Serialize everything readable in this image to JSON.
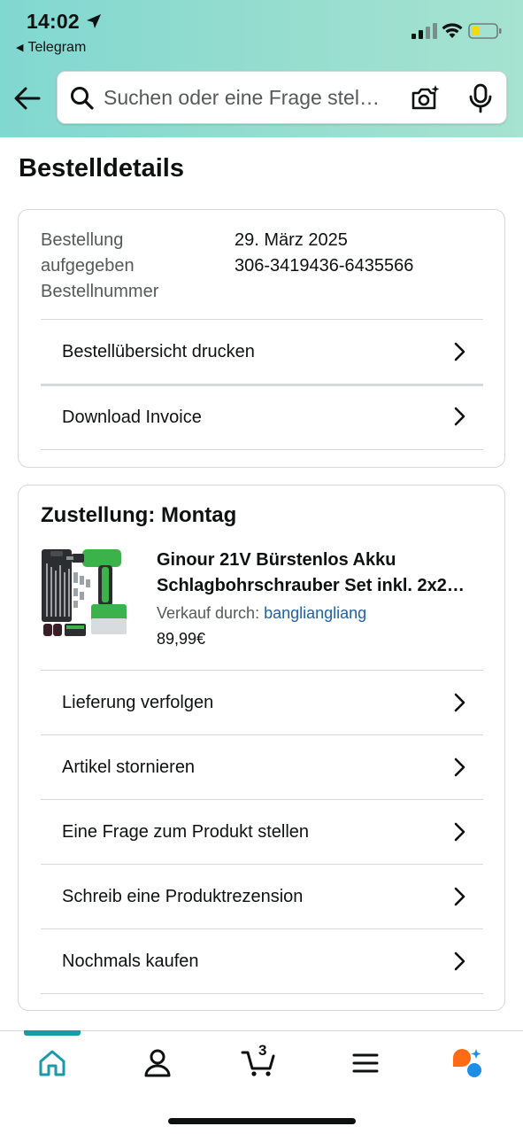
{
  "status_bar": {
    "time": "14:02",
    "back_app": "Telegram"
  },
  "header": {
    "search_placeholder": "Suchen oder eine Frage stel…",
    "accent_bg": "#92dccf"
  },
  "page": {
    "title": "Bestelldetails"
  },
  "order_card": {
    "label_line1": "Bestellung",
    "label_line2": "aufgegeben",
    "label_line3": "Bestellnummer",
    "order_date": "29. März 2025",
    "order_number": "306-3419436-6435566",
    "actions": [
      {
        "label": "Bestellübersicht drucken"
      },
      {
        "label": "Download Invoice"
      }
    ]
  },
  "delivery_card": {
    "title": "Zustellung: Montag",
    "product": {
      "title_line1": "Ginour 21V Bürstenlos Akku",
      "title_line2": "Schlagbohrschrauber Set inkl. 2x2…",
      "seller_label": "Verkauf durch: ",
      "seller_name": "bangliangliang",
      "price": "89,99€"
    },
    "actions": [
      {
        "label": "Lieferung verfolgen"
      },
      {
        "label": "Artikel stornieren"
      },
      {
        "label": "Eine Frage zum Produkt stellen"
      },
      {
        "label": "Schreib eine Produktrezension"
      },
      {
        "label": "Nochmals kaufen"
      }
    ]
  },
  "tabbar": {
    "cart_count": "3",
    "active_tab": "home",
    "accent": "#1a9aa8"
  }
}
